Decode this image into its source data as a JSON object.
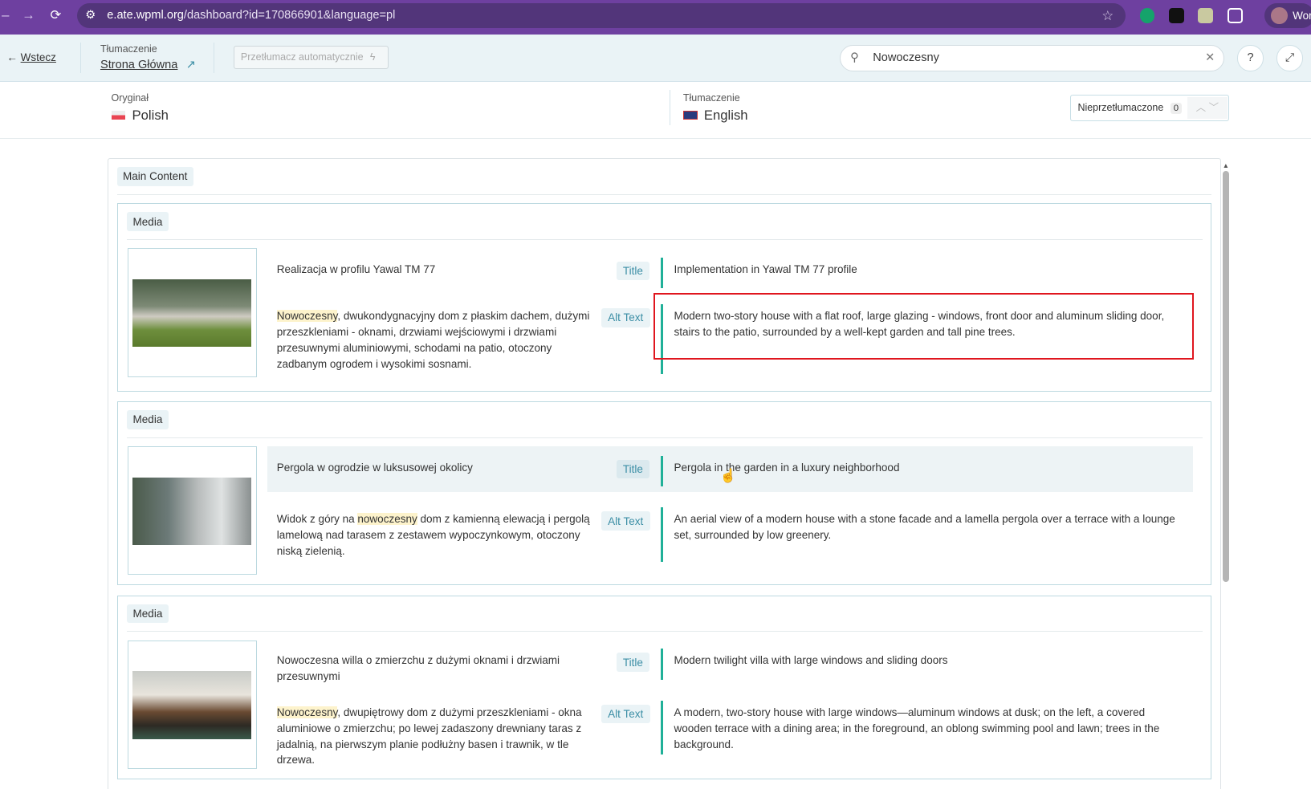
{
  "browser": {
    "url_host": "e.ate.wpml.org",
    "url_path": "/dashboard?id=170866901&language=pl",
    "profile": "Wor"
  },
  "header": {
    "back": "Wstecz",
    "translation_label": "Tłumaczenie",
    "page_name": "Strona Główna",
    "auto_translate": "Przetłumacz automatycznie",
    "search_value": "Nowoczesny",
    "search_placeholder": "Nowoczesny"
  },
  "languages": {
    "original_label": "Oryginał",
    "original": "Polish",
    "translation_label": "Tłumaczenie",
    "translation": "English",
    "untranslated_label": "Nieprzetłumaczone",
    "untranslated_count": "0"
  },
  "section": "Main Content",
  "media": [
    {
      "label": "Media",
      "title_src": "Realizacja w profilu Yawal TM 77",
      "title_tgt": "Implementation in Yawal TM 77 profile",
      "alt_hl": "Nowoczesny",
      "alt_pre": "",
      "alt_src": ", dwukondygnacyjny dom z płaskim dachem, dużymi przeszkleniami - oknami, drzwiami wejściowymi i drzwiami przesuwnymi aluminiowymi, schodami na patio, otoczony zadbanym ogrodem i wysokimi sosnami.",
      "alt_tgt": "Modern two-story house with a flat roof, large glazing - windows, front door and aluminum sliding door, stairs to the patio, surrounded by a well-kept garden and tall pine trees."
    },
    {
      "label": "Media",
      "title_src": "Pergola w ogrodzie w luksusowej okolicy",
      "title_tgt": "Pergola in the garden in a luxury neighborhood",
      "alt_pre": "Widok z góry na ",
      "alt_hl": "nowoczesny",
      "alt_src": " dom z kamienną elewacją i pergolą lamelową nad tarasem z zestawem wypoczynkowym, otoczony niską zielenią.",
      "alt_tgt": "An aerial view of a modern house with a stone facade and a lamella pergola over a terrace with a lounge set, surrounded by low greenery."
    },
    {
      "label": "Media",
      "title_src": "Nowoczesna willa o zmierzchu z dużymi oknami i drzwiami przesuwnymi",
      "title_tgt": "Modern twilight villa with large windows and sliding doors",
      "alt_pre": "",
      "alt_hl": "Nowoczesny",
      "alt_src": ", dwupiętrowy dom z dużymi przeszkleniami - okna aluminiowe o zmierzchu; po lewej zadaszony drewniany taras z jadalnią, na pierwszym planie podłużny basen i trawnik, w tle drzewa.",
      "alt_tgt": "A modern, two-story house with large windows—aluminum windows at dusk; on the left, a covered wooden terrace with a dining area; in the foreground, an oblong swimming pool and lawn; trees in the background."
    }
  ],
  "field_labels": {
    "title": "Title",
    "alt": "Alt Text"
  }
}
